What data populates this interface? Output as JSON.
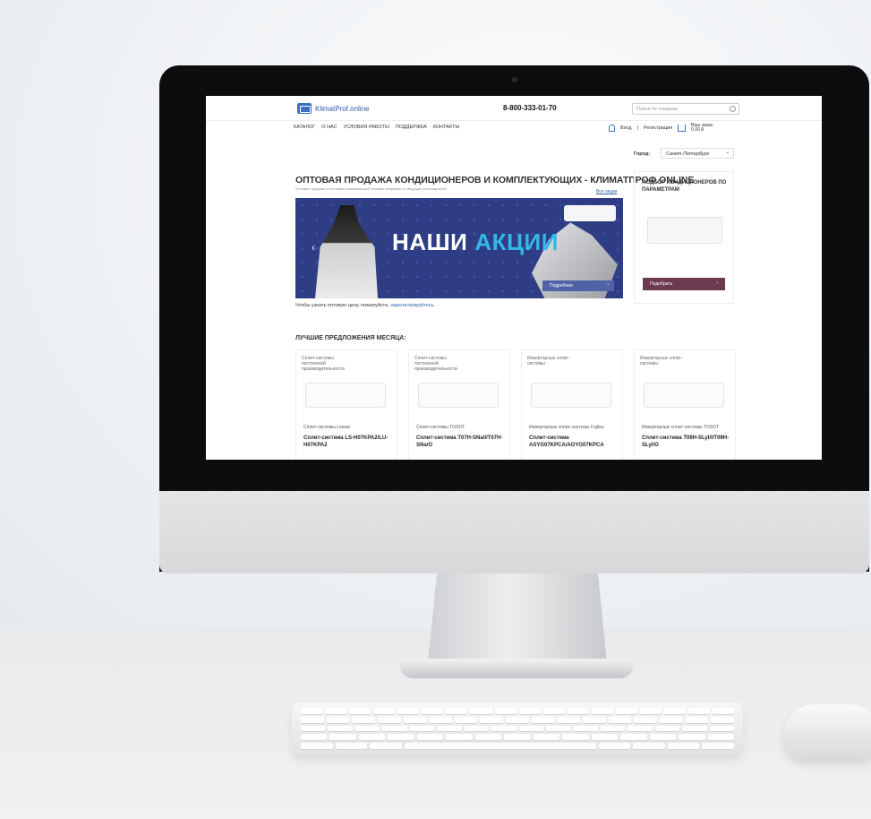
{
  "site": {
    "logo_text": "KlimatProf.online",
    "phone": "8-800-333-01-70",
    "search_placeholder": "Поиск по товарам"
  },
  "nav": {
    "items": [
      {
        "label": "КАТАЛОГ"
      },
      {
        "label": "О НАС"
      },
      {
        "label": "УСЛОВИЯ РАБОТЫ"
      },
      {
        "label": "ПОДДЕРЖКА"
      },
      {
        "label": "КОНТАКТЫ"
      }
    ]
  },
  "account": {
    "login": "Вход",
    "separator": "|",
    "register": "Регистрация",
    "cart_label": "Ваш заказ",
    "cart_total": "0.00 ₽"
  },
  "city": {
    "label": "Город:",
    "value": "Санкт-Петербург"
  },
  "hero": {
    "title": "ОПТОВАЯ ПРОДАЖА КОНДИЦИОНЕРОВ И КОМПЛЕКТУЮЩИХ - КЛИМАТПРОФ.ONLINE",
    "subtitle": "Оптовые продажи и поставки климатической техники напрямую от ведущих изготовителей",
    "all_news": "Все акции"
  },
  "banner": {
    "text_white": "НАШИ",
    "text_blue": "АКЦИИ",
    "button": "Подробнее"
  },
  "register_line": {
    "text": "Чтобы узнать оптовую цену, пожалуйста,",
    "link": "зарегистрируйтесь."
  },
  "sidebar": {
    "title": "ПОДБОР КОНДИЦИОНЕРОВ ПО ПАРАМЕТРАМ",
    "button": "Подобрать"
  },
  "best": {
    "title": "ЛУЧШИЕ ПРЕДЛОЖЕНИЯ МЕСЯЦА:",
    "cards": [
      {
        "category": "Сплит-системы постоянной производительности",
        "brand": "Сплит-системы Lessar",
        "name": "Сплит-система LS-H07KPA2/LU-H07KPA2"
      },
      {
        "category": "Сплит-системы постоянной производительности",
        "brand": "Сплит-системы TOSOT",
        "name": "Сплит-система T07H-SNa/I/T07H-SNa/O"
      },
      {
        "category": "Инверторные сплит-системы",
        "brand": "Инверторные сплит-системы Fujitsu",
        "name": "Сплит-система ASYG07KPCA/AOYG07KPCA"
      },
      {
        "category": "Инверторные сплит-системы",
        "brand": "Инверторные сплит-системы TOSOT",
        "name": "Сплит-система T09H-SLyI/I/T09H-SLyI/O"
      }
    ]
  }
}
